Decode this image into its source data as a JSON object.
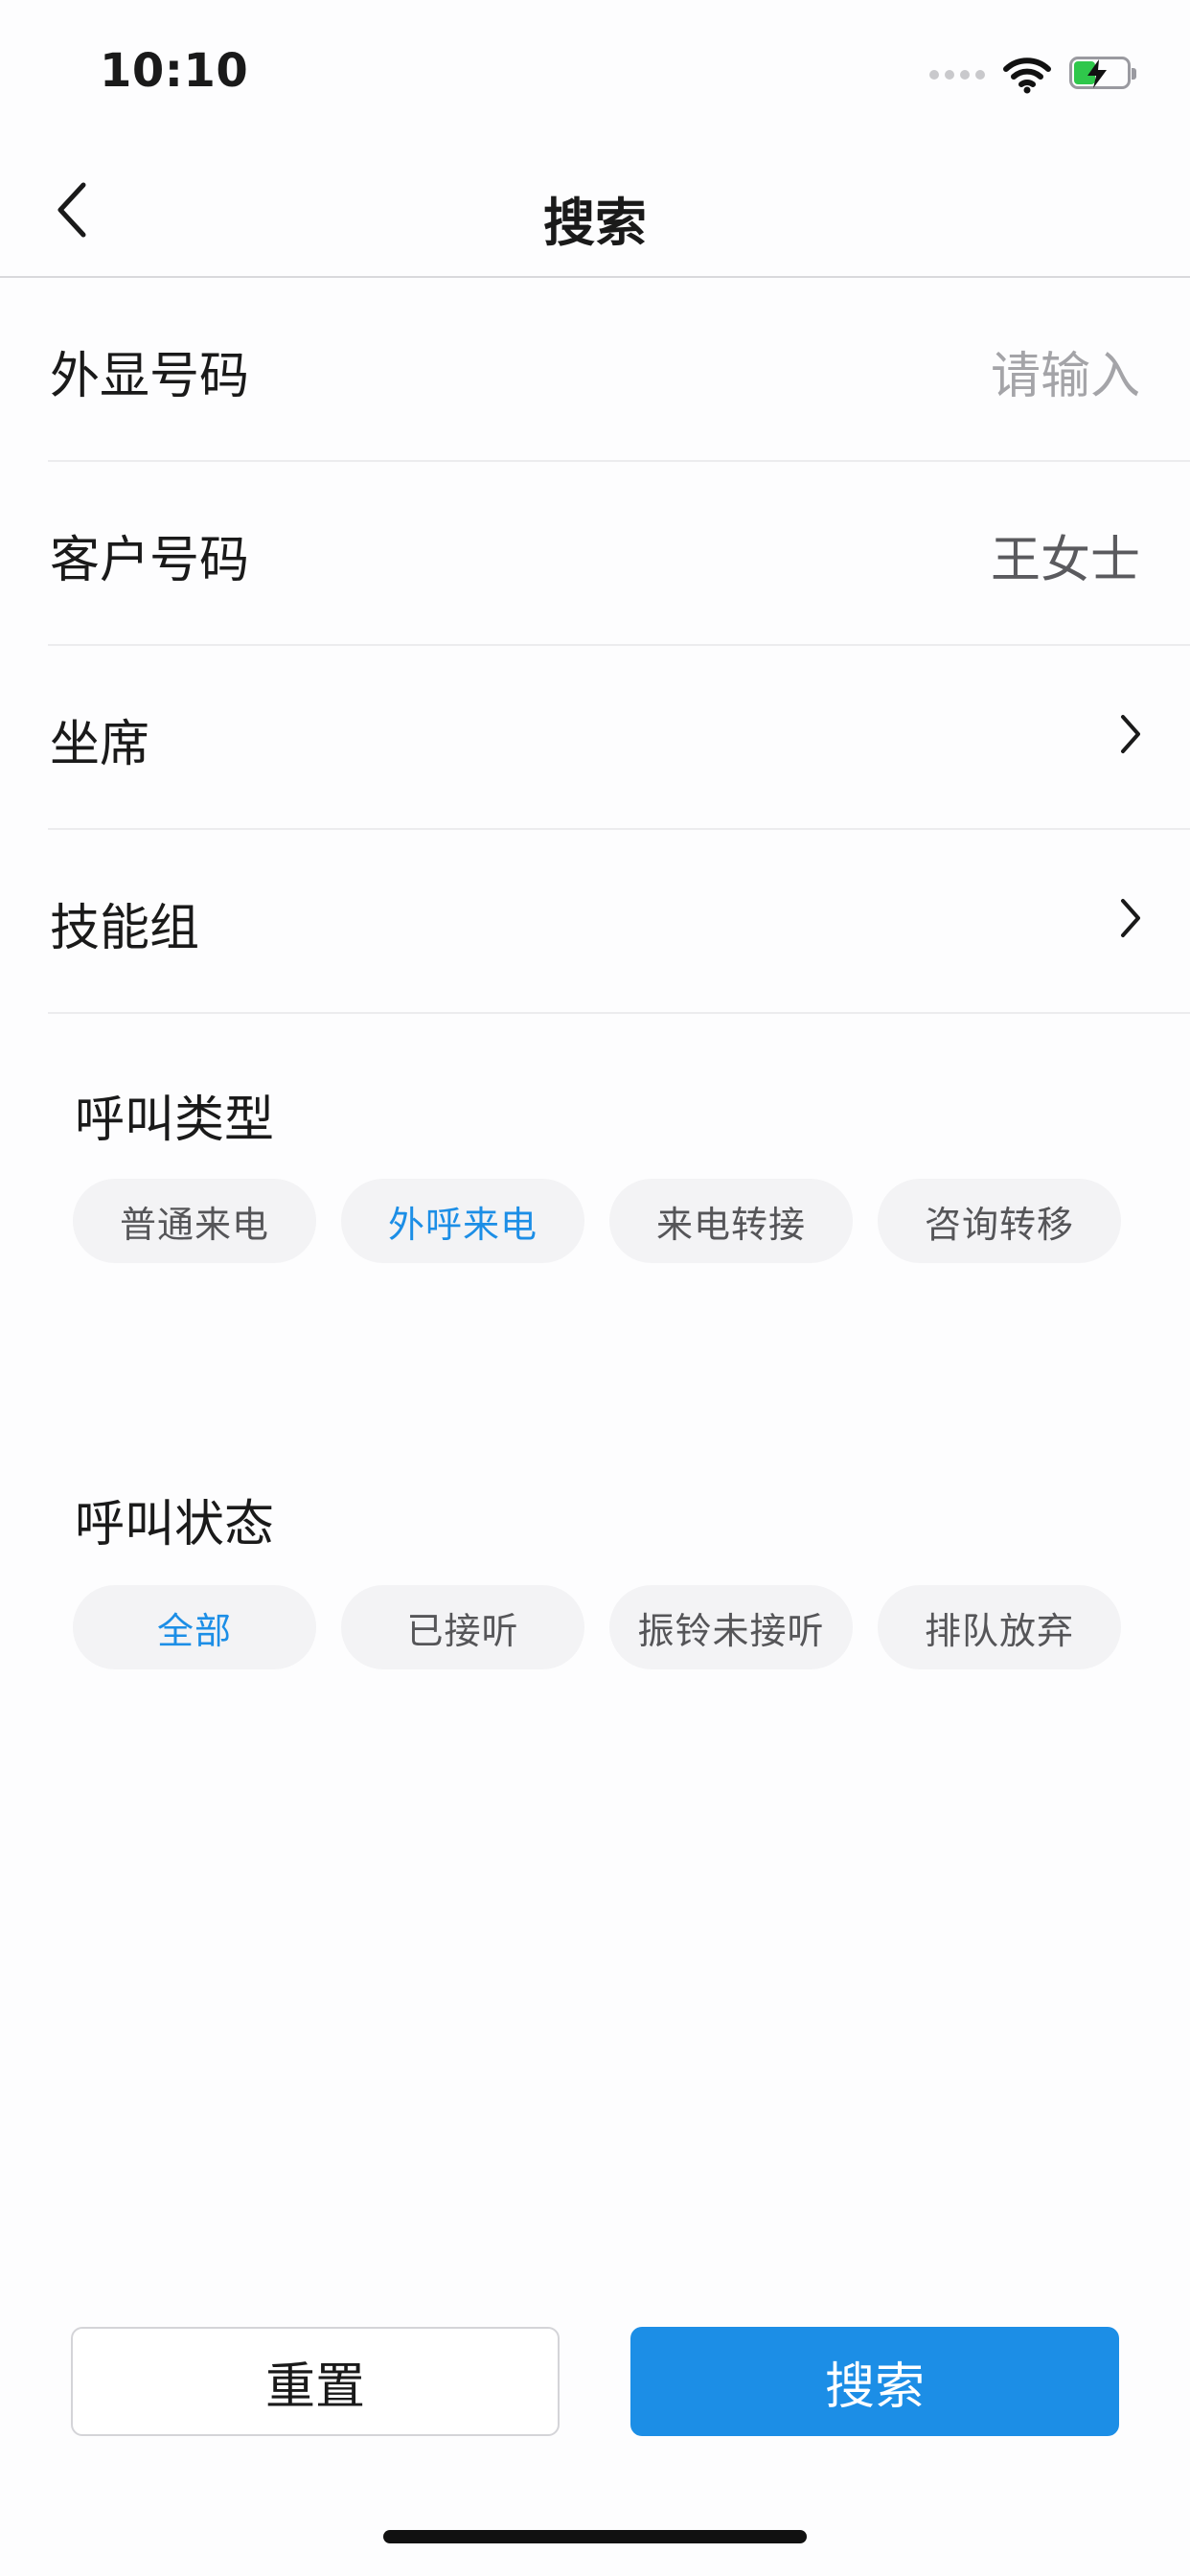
{
  "status_bar": {
    "time": "10:10"
  },
  "nav": {
    "title": "搜索",
    "back_icon": "chevron-left-icon"
  },
  "form": {
    "display_number": {
      "label": "外显号码",
      "placeholder": "请输入"
    },
    "customer_number": {
      "label": "客户号码",
      "value": "王女士"
    },
    "agent": {
      "label": "坐席"
    },
    "skill_group": {
      "label": "技能组"
    }
  },
  "call_type": {
    "title": "呼叫类型",
    "options": [
      "普通来电",
      "外呼来电",
      "来电转接",
      "咨询转移"
    ],
    "selected": "外呼来电"
  },
  "call_status": {
    "title": "呼叫状态",
    "options": [
      "全部",
      "已接听",
      "振铃未接听",
      "排队放弃"
    ],
    "selected": "全部"
  },
  "buttons": {
    "reset": "重置",
    "search": "搜索"
  },
  "colors": {
    "accent": "#1c8ee6",
    "chip_bg": "#f3f3f5",
    "battery_green": "#2fc74b"
  }
}
